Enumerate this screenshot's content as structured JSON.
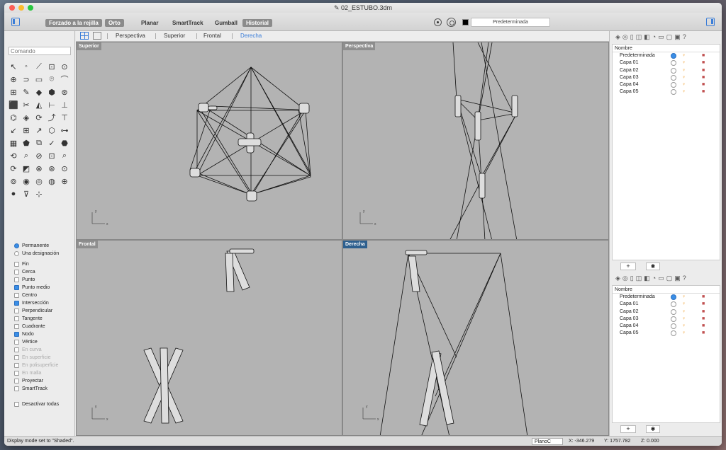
{
  "window": {
    "title": "02_ESTUBO.3dm"
  },
  "toolbar": {
    "buttons": [
      {
        "label": "Forzado a la rejilla",
        "on": true
      },
      {
        "label": "Orto",
        "on": true
      },
      {
        "label": "Planar",
        "on": false
      },
      {
        "label": "SmartTrack",
        "on": false
      },
      {
        "label": "Gumball",
        "on": false
      },
      {
        "label": "Historial",
        "on": true
      }
    ],
    "layer_select": "Predeterminada"
  },
  "command": {
    "placeholder": "Comando"
  },
  "tools": [
    "↖",
    "◦",
    "⟋",
    "⊡",
    "⊙",
    "⊕",
    "⊃",
    "▭",
    "⌾",
    "⌒",
    "⊞",
    "✎",
    "◆",
    "⬢",
    "⊛",
    "⬛",
    "✂",
    "◭",
    "⊢",
    "⊥",
    "⌬",
    "◈",
    "⟳",
    "⤴",
    "⊤",
    "↙",
    "⊞",
    "↗",
    "⬡",
    "⊶",
    "▦",
    "⬟",
    "⧉",
    "✓",
    "⬣",
    "⟲",
    "⌕",
    "⊘",
    "⊡",
    "⌕",
    "⟳",
    "◩",
    "⊗",
    "⊛",
    "⊙",
    "⊚",
    "◉",
    "◎",
    "◍",
    "⊕",
    "●",
    "⊽",
    "⊹"
  ],
  "snaps": {
    "modes": [
      {
        "label": "Permanente",
        "on": true
      },
      {
        "label": "Una designación",
        "on": false
      }
    ],
    "items": [
      {
        "label": "Fin",
        "on": false,
        "dim": false
      },
      {
        "label": "Cerca",
        "on": false,
        "dim": false
      },
      {
        "label": "Punto",
        "on": false,
        "dim": false
      },
      {
        "label": "Punto medio",
        "on": true,
        "dim": false
      },
      {
        "label": "Centro",
        "on": false,
        "dim": false
      },
      {
        "label": "Intersección",
        "on": true,
        "dim": false
      },
      {
        "label": "Perpendicular",
        "on": false,
        "dim": false
      },
      {
        "label": "Tangente",
        "on": false,
        "dim": false
      },
      {
        "label": "Cuadrante",
        "on": false,
        "dim": false
      },
      {
        "label": "Nodo",
        "on": true,
        "dim": false
      },
      {
        "label": "Vértice",
        "on": false,
        "dim": false
      },
      {
        "label": "En curva",
        "on": false,
        "dim": true
      },
      {
        "label": "En superficie",
        "on": false,
        "dim": true
      },
      {
        "label": "En polisuperficie",
        "on": false,
        "dim": true
      },
      {
        "label": "En malla",
        "on": false,
        "dim": true
      },
      {
        "label": "Proyectar",
        "on": false,
        "dim": false
      },
      {
        "label": "SmartTrack",
        "on": false,
        "dim": false
      }
    ],
    "disable_all": "Desactivar todas"
  },
  "viewport_tabs": [
    "Perspectiva",
    "Superior",
    "Frontal",
    "Derecha"
  ],
  "active_tab": "Derecha",
  "viewports": {
    "top": "Superior",
    "perspective": "Perspectiva",
    "front": "Frontal",
    "right": "Derecha",
    "axis_x": "x",
    "axis_y": "y"
  },
  "layers": {
    "header": "Nombre",
    "items": [
      "Predeterminada",
      "Capa 01",
      "Capa 02",
      "Capa 03",
      "Capa 04",
      "Capa 05"
    ],
    "current": "Predeterminada"
  },
  "status": {
    "message": "Display mode set to \"Shaded\".",
    "plane": "PlanoC",
    "x": "X: -346.279",
    "y": "Y: 1757.782",
    "z": "Z: 0.000"
  },
  "colors": {
    "accent": "#3a7dd8",
    "viewport_bg": "#b3b3b3",
    "active_label": "#2d5f8e"
  }
}
